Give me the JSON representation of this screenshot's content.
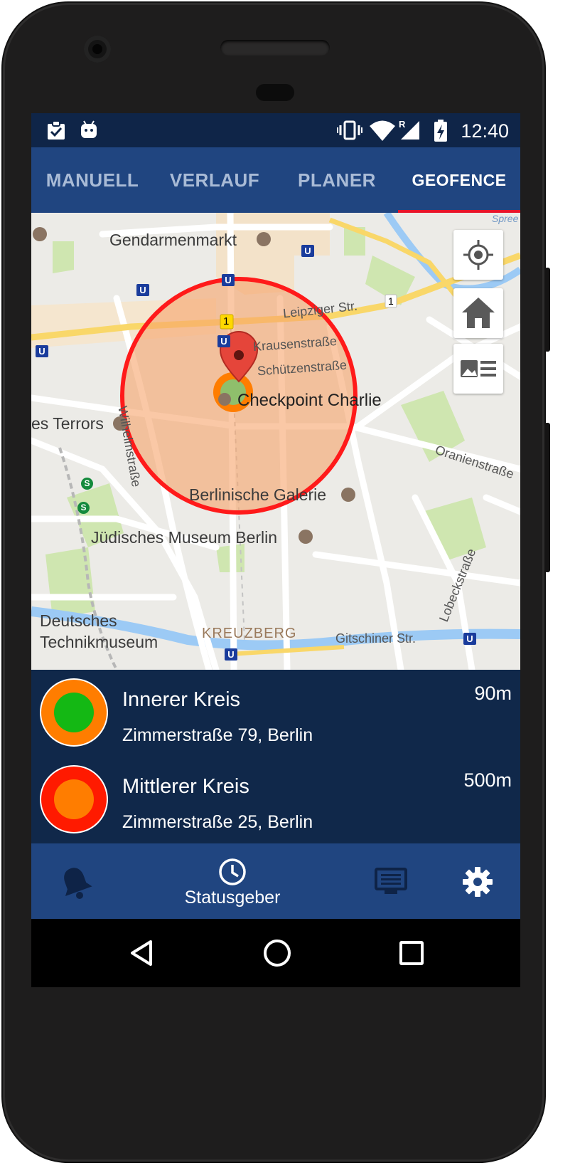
{
  "status_bar": {
    "time": "12:40",
    "icons": [
      "clipboard-check-icon",
      "android-icon",
      "vibrate-icon",
      "wifi-icon",
      "signal-roaming-icon",
      "battery-charging-icon"
    ],
    "roaming_mark": "R"
  },
  "tabs": [
    {
      "label": "MANUELL",
      "active": false
    },
    {
      "label": "VERLAUF",
      "active": false
    },
    {
      "label": "PLANER",
      "active": false
    },
    {
      "label": "GEOFENCE",
      "active": true
    }
  ],
  "map": {
    "labels": {
      "gendarmenmarkt": "Gendarmenmarkt",
      "leipziger": "Leipziger Str.",
      "krausen": "Krausenstraße",
      "schuetzen": "Schützenstraße",
      "checkpoint": "Checkpoint Charlie",
      "wilhelm": "Wilhelmstraße",
      "terrors": "es Terrors",
      "oranien": "Oranienstraße",
      "galerie": "Berlinische Galerie",
      "museum": "Jüdisches Museum Berlin",
      "lobeck": "Lobeckstraße",
      "technik1": "Deutsches",
      "technik2": "Technikmuseum",
      "kreuzberg": "KREUZBERG",
      "gitschiner": "Gitschiner Str.",
      "spree": "Spree",
      "road_number": "1",
      "road_number_2": "1",
      "ubahn": "U",
      "sbahn": "S"
    },
    "buttons": [
      "my-location-icon",
      "home-icon",
      "image-list-icon"
    ],
    "fence_color": "#ff1a1a",
    "fence_fill": "#f7a46a"
  },
  "geofences": [
    {
      "name": "Innerer Kreis",
      "address": "Zimmerstraße 79, Berlin",
      "radius": "90m",
      "outer_color": "#ff7d00",
      "inner_color": "#14b814"
    },
    {
      "name": "Mittlerer Kreis",
      "address": "Zimmerstraße 25, Berlin",
      "radius": "500m",
      "outer_color": "#ff1a00",
      "inner_color": "#ff7d00"
    }
  ],
  "bottom_nav": [
    {
      "icon": "bell-icon",
      "label": ""
    },
    {
      "icon": "clock-icon",
      "label": "Statusgeber"
    },
    {
      "icon": "message-board-icon",
      "label": ""
    },
    {
      "icon": "gear-icon",
      "label": ""
    }
  ],
  "system_nav": [
    "back-icon",
    "home-circle-icon",
    "recents-icon"
  ],
  "colors": {
    "status_bar": "#0f2548",
    "tab_bar": "#204580",
    "list_bg": "#10284a",
    "tab_indicator": "#e8142a"
  }
}
